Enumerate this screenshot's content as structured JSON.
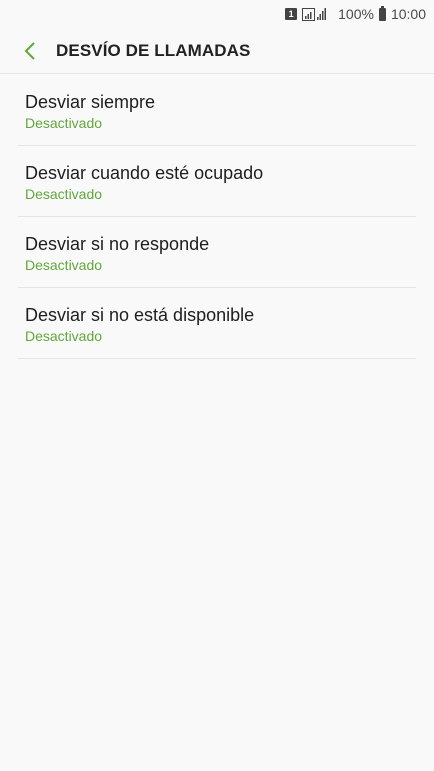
{
  "status": {
    "sim": "1",
    "battery": "100%",
    "time": "10:00"
  },
  "header": {
    "title": "DESVÍO DE LLAMADAS"
  },
  "colors": {
    "accent": "#63a53f"
  },
  "items": [
    {
      "title": "Desviar siempre",
      "status": "Desactivado"
    },
    {
      "title": "Desviar cuando esté ocupado",
      "status": "Desactivado"
    },
    {
      "title": "Desviar si no responde",
      "status": "Desactivado"
    },
    {
      "title": "Desviar si no está disponible",
      "status": "Desactivado"
    }
  ]
}
